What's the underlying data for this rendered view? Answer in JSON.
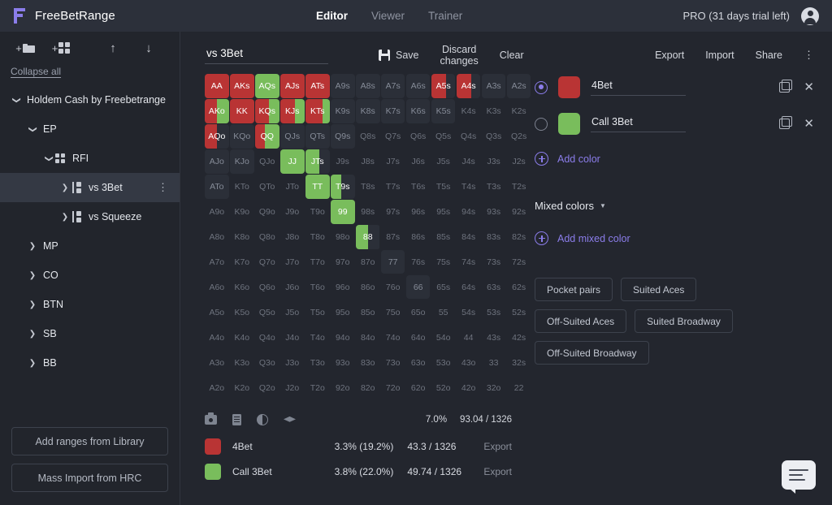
{
  "header": {
    "brand": "FreeBetRange",
    "logo_icon": "freebetrange-logo",
    "nav": [
      {
        "label": "Editor",
        "active": true
      },
      {
        "label": "Viewer",
        "active": false
      },
      {
        "label": "Trainer",
        "active": false
      }
    ],
    "pro_label": "PRO (31 days trial left)",
    "account_icon": "account-circle-icon"
  },
  "sidebar": {
    "tools": [
      {
        "name": "add-folder",
        "icon": "plus-folder-icon"
      },
      {
        "name": "add-range",
        "icon": "plus-grid-icon"
      },
      {
        "name": "move-up",
        "icon": "arrow-up-icon"
      },
      {
        "name": "move-down",
        "icon": "arrow-down-icon"
      }
    ],
    "collapse_all": "Collapse all",
    "tree": [
      {
        "label": "Holdem Cash by Freebetrange",
        "indent": 0,
        "chevron": "down",
        "icon": null,
        "selected": false
      },
      {
        "label": "EP",
        "indent": 1,
        "chevron": "down",
        "icon": null,
        "selected": false
      },
      {
        "label": "RFI",
        "indent": 2,
        "chevron": "down",
        "icon": "grid",
        "selected": false
      },
      {
        "label": "vs 3Bet",
        "indent": 3,
        "chevron": "right",
        "icon": "range",
        "selected": true
      },
      {
        "label": "vs Squeeze",
        "indent": 3,
        "chevron": "right",
        "icon": "range",
        "selected": false
      },
      {
        "label": "MP",
        "indent": 1,
        "chevron": "right",
        "icon": null,
        "selected": false
      },
      {
        "label": "CO",
        "indent": 1,
        "chevron": "right",
        "icon": null,
        "selected": false
      },
      {
        "label": "BTN",
        "indent": 1,
        "chevron": "right",
        "icon": null,
        "selected": false
      },
      {
        "label": "SB",
        "indent": 1,
        "chevron": "right",
        "icon": null,
        "selected": false
      },
      {
        "label": "BB",
        "indent": 1,
        "chevron": "right",
        "icon": null,
        "selected": false
      }
    ],
    "buttons": [
      {
        "label": "Add ranges from Library"
      },
      {
        "label": "Mass Import from HRC"
      }
    ]
  },
  "editor": {
    "range_name": "vs 3Bet",
    "actions": [
      {
        "label": "Save",
        "icon": "save-icon"
      },
      {
        "label": "Discard changes",
        "icon": null
      },
      {
        "label": "Clear",
        "icon": null
      }
    ],
    "mini_tools": [
      {
        "name": "screenshot",
        "icon": "camera-icon"
      },
      {
        "name": "notes",
        "icon": "document-icon"
      },
      {
        "name": "contrast",
        "icon": "contrast-icon"
      },
      {
        "name": "study",
        "icon": "graduation-cap-icon"
      }
    ],
    "total_pct": "7.0%",
    "total_combos": "93.04 / 1326",
    "legend": [
      {
        "color": "#b93434",
        "name": "4Bet",
        "pct": "3.3% (19.2%)",
        "combos": "43.3 / 1326",
        "export": "Export"
      },
      {
        "color": "#79bd5c",
        "name": "Call 3Bet",
        "pct": "3.8% (22.0%)",
        "combos": "49.74 / 1326",
        "export": "Export"
      }
    ]
  },
  "right_panel": {
    "actions": [
      {
        "label": "Export"
      },
      {
        "label": "Import"
      },
      {
        "label": "Share"
      }
    ],
    "kebab_icon": "more-vertical-icon",
    "colors": [
      {
        "name": "4Bet",
        "color": "#b93434",
        "selected": true,
        "copy_icon": "copy-icon",
        "delete_icon": "close-icon"
      },
      {
        "name": "Call 3Bet",
        "color": "#79bd5c",
        "selected": false,
        "copy_icon": "copy-icon",
        "delete_icon": "close-icon"
      }
    ],
    "add_color": "Add color",
    "mixed_colors_title": "Mixed colors",
    "add_mixed_color": "Add mixed color",
    "presets": [
      "Pocket pairs",
      "Suited Aces",
      "Off-Suited Aces",
      "Suited Broadway",
      "Off-Suited Broadway"
    ]
  },
  "chat_icon": "chat-bubble-icon",
  "palette": {
    "red": "#b93434",
    "green": "#79bd5c",
    "empty": "#2b2f38",
    "accent": "#8b7dea"
  },
  "matrix": {
    "ranks": [
      "A",
      "K",
      "Q",
      "J",
      "T",
      "9",
      "8",
      "7",
      "6",
      "5",
      "4",
      "3",
      "2"
    ],
    "cells": [
      {
        "h": "AA",
        "red": 100,
        "green": 0
      },
      {
        "h": "AKs",
        "red": 100,
        "green": 0
      },
      {
        "h": "AQs",
        "red": 0,
        "green": 100
      },
      {
        "h": "AJs",
        "red": 100,
        "green": 0
      },
      {
        "h": "ATs",
        "red": 100,
        "green": 0
      },
      {
        "h": "A9s",
        "red": 0,
        "green": 0,
        "hl": true
      },
      {
        "h": "A8s",
        "red": 0,
        "green": 0,
        "hl": true
      },
      {
        "h": "A7s",
        "red": 0,
        "green": 0,
        "hl": true
      },
      {
        "h": "A6s",
        "red": 0,
        "green": 0,
        "hl": true
      },
      {
        "h": "A5s",
        "red": 62,
        "green": 0,
        "hl": true
      },
      {
        "h": "A4s",
        "red": 62,
        "green": 0,
        "hl": true
      },
      {
        "h": "A3s",
        "red": 0,
        "green": 0,
        "hl": true
      },
      {
        "h": "A2s",
        "red": 0,
        "green": 0,
        "hl": true
      },
      {
        "h": "AKo",
        "red": 52,
        "green": 48
      },
      {
        "h": "KK",
        "red": 100,
        "green": 0
      },
      {
        "h": "KQs",
        "red": 58,
        "green": 42
      },
      {
        "h": "KJs",
        "red": 62,
        "green": 38
      },
      {
        "h": "KTs",
        "red": 70,
        "green": 30
      },
      {
        "h": "K9s",
        "red": 0,
        "green": 0,
        "hl": true
      },
      {
        "h": "K8s",
        "red": 0,
        "green": 0,
        "hl": true
      },
      {
        "h": "K7s",
        "red": 0,
        "green": 0,
        "hl": true
      },
      {
        "h": "K6s",
        "red": 0,
        "green": 0,
        "hl": true
      },
      {
        "h": "K5s",
        "red": 0,
        "green": 0,
        "hl": true
      },
      {
        "h": "K4s",
        "red": 0,
        "green": 0
      },
      {
        "h": "K3s",
        "red": 0,
        "green": 0
      },
      {
        "h": "K2s",
        "red": 0,
        "green": 0
      },
      {
        "h": "AQo",
        "red": 52,
        "green": 0,
        "hl": true
      },
      {
        "h": "KQo",
        "red": 0,
        "green": 0,
        "hl": true
      },
      {
        "h": "QQ",
        "red": 40,
        "green": 60
      },
      {
        "h": "QJs",
        "red": 0,
        "green": 0,
        "hl": true
      },
      {
        "h": "QTs",
        "red": 0,
        "green": 0,
        "hl": true
      },
      {
        "h": "Q9s",
        "red": 0,
        "green": 0,
        "hl": true
      },
      {
        "h": "Q8s",
        "red": 0,
        "green": 0
      },
      {
        "h": "Q7s",
        "red": 0,
        "green": 0
      },
      {
        "h": "Q6s",
        "red": 0,
        "green": 0
      },
      {
        "h": "Q5s",
        "red": 0,
        "green": 0
      },
      {
        "h": "Q4s",
        "red": 0,
        "green": 0
      },
      {
        "h": "Q3s",
        "red": 0,
        "green": 0
      },
      {
        "h": "Q2s",
        "red": 0,
        "green": 0
      },
      {
        "h": "AJo",
        "red": 0,
        "green": 0,
        "hl": true
      },
      {
        "h": "KJo",
        "red": 0,
        "green": 0,
        "hl": true
      },
      {
        "h": "QJo",
        "red": 0,
        "green": 0
      },
      {
        "h": "JJ",
        "red": 0,
        "green": 100
      },
      {
        "h": "JTs",
        "red": 0,
        "green": 58,
        "hl": true
      },
      {
        "h": "J9s",
        "red": 0,
        "green": 0
      },
      {
        "h": "J8s",
        "red": 0,
        "green": 0
      },
      {
        "h": "J7s",
        "red": 0,
        "green": 0
      },
      {
        "h": "J6s",
        "red": 0,
        "green": 0
      },
      {
        "h": "J5s",
        "red": 0,
        "green": 0
      },
      {
        "h": "J4s",
        "red": 0,
        "green": 0
      },
      {
        "h": "J3s",
        "red": 0,
        "green": 0
      },
      {
        "h": "J2s",
        "red": 0,
        "green": 0
      },
      {
        "h": "ATo",
        "red": 0,
        "green": 0,
        "hl": true
      },
      {
        "h": "KTo",
        "red": 0,
        "green": 0
      },
      {
        "h": "QTo",
        "red": 0,
        "green": 0
      },
      {
        "h": "JTo",
        "red": 0,
        "green": 0
      },
      {
        "h": "TT",
        "red": 0,
        "green": 100
      },
      {
        "h": "T9s",
        "red": 0,
        "green": 45,
        "hl": true
      },
      {
        "h": "T8s",
        "red": 0,
        "green": 0
      },
      {
        "h": "T7s",
        "red": 0,
        "green": 0
      },
      {
        "h": "T6s",
        "red": 0,
        "green": 0
      },
      {
        "h": "T5s",
        "red": 0,
        "green": 0
      },
      {
        "h": "T4s",
        "red": 0,
        "green": 0
      },
      {
        "h": "T3s",
        "red": 0,
        "green": 0
      },
      {
        "h": "T2s",
        "red": 0,
        "green": 0
      },
      {
        "h": "A9o",
        "red": 0,
        "green": 0
      },
      {
        "h": "K9o",
        "red": 0,
        "green": 0
      },
      {
        "h": "Q9o",
        "red": 0,
        "green": 0
      },
      {
        "h": "J9o",
        "red": 0,
        "green": 0
      },
      {
        "h": "T9o",
        "red": 0,
        "green": 0
      },
      {
        "h": "99",
        "red": 0,
        "green": 100
      },
      {
        "h": "98s",
        "red": 0,
        "green": 0
      },
      {
        "h": "97s",
        "red": 0,
        "green": 0
      },
      {
        "h": "96s",
        "red": 0,
        "green": 0
      },
      {
        "h": "95s",
        "red": 0,
        "green": 0
      },
      {
        "h": "94s",
        "red": 0,
        "green": 0
      },
      {
        "h": "93s",
        "red": 0,
        "green": 0
      },
      {
        "h": "92s",
        "red": 0,
        "green": 0
      },
      {
        "h": "A8o",
        "red": 0,
        "green": 0
      },
      {
        "h": "K8o",
        "red": 0,
        "green": 0
      },
      {
        "h": "Q8o",
        "red": 0,
        "green": 0
      },
      {
        "h": "J8o",
        "red": 0,
        "green": 0
      },
      {
        "h": "T8o",
        "red": 0,
        "green": 0
      },
      {
        "h": "98o",
        "red": 0,
        "green": 0
      },
      {
        "h": "88",
        "red": 0,
        "green": 52,
        "hl": true
      },
      {
        "h": "87s",
        "red": 0,
        "green": 0
      },
      {
        "h": "86s",
        "red": 0,
        "green": 0
      },
      {
        "h": "85s",
        "red": 0,
        "green": 0
      },
      {
        "h": "84s",
        "red": 0,
        "green": 0
      },
      {
        "h": "83s",
        "red": 0,
        "green": 0
      },
      {
        "h": "82s",
        "red": 0,
        "green": 0
      },
      {
        "h": "A7o",
        "red": 0,
        "green": 0
      },
      {
        "h": "K7o",
        "red": 0,
        "green": 0
      },
      {
        "h": "Q7o",
        "red": 0,
        "green": 0
      },
      {
        "h": "J7o",
        "red": 0,
        "green": 0
      },
      {
        "h": "T7o",
        "red": 0,
        "green": 0
      },
      {
        "h": "97o",
        "red": 0,
        "green": 0
      },
      {
        "h": "87o",
        "red": 0,
        "green": 0
      },
      {
        "h": "77",
        "red": 0,
        "green": 0,
        "hl": true
      },
      {
        "h": "76s",
        "red": 0,
        "green": 0
      },
      {
        "h": "75s",
        "red": 0,
        "green": 0
      },
      {
        "h": "74s",
        "red": 0,
        "green": 0
      },
      {
        "h": "73s",
        "red": 0,
        "green": 0
      },
      {
        "h": "72s",
        "red": 0,
        "green": 0
      },
      {
        "h": "A6o",
        "red": 0,
        "green": 0
      },
      {
        "h": "K6o",
        "red": 0,
        "green": 0
      },
      {
        "h": "Q6o",
        "red": 0,
        "green": 0
      },
      {
        "h": "J6o",
        "red": 0,
        "green": 0
      },
      {
        "h": "T6o",
        "red": 0,
        "green": 0
      },
      {
        "h": "96o",
        "red": 0,
        "green": 0
      },
      {
        "h": "86o",
        "red": 0,
        "green": 0
      },
      {
        "h": "76o",
        "red": 0,
        "green": 0
      },
      {
        "h": "66",
        "red": 0,
        "green": 0,
        "hl": true
      },
      {
        "h": "65s",
        "red": 0,
        "green": 0
      },
      {
        "h": "64s",
        "red": 0,
        "green": 0
      },
      {
        "h": "63s",
        "red": 0,
        "green": 0
      },
      {
        "h": "62s",
        "red": 0,
        "green": 0
      },
      {
        "h": "A5o",
        "red": 0,
        "green": 0
      },
      {
        "h": "K5o",
        "red": 0,
        "green": 0
      },
      {
        "h": "Q5o",
        "red": 0,
        "green": 0
      },
      {
        "h": "J5o",
        "red": 0,
        "green": 0
      },
      {
        "h": "T5o",
        "red": 0,
        "green": 0
      },
      {
        "h": "95o",
        "red": 0,
        "green": 0
      },
      {
        "h": "85o",
        "red": 0,
        "green": 0
      },
      {
        "h": "75o",
        "red": 0,
        "green": 0
      },
      {
        "h": "65o",
        "red": 0,
        "green": 0
      },
      {
        "h": "55",
        "red": 0,
        "green": 0
      },
      {
        "h": "54s",
        "red": 0,
        "green": 0
      },
      {
        "h": "53s",
        "red": 0,
        "green": 0
      },
      {
        "h": "52s",
        "red": 0,
        "green": 0
      },
      {
        "h": "A4o",
        "red": 0,
        "green": 0
      },
      {
        "h": "K4o",
        "red": 0,
        "green": 0
      },
      {
        "h": "Q4o",
        "red": 0,
        "green": 0
      },
      {
        "h": "J4o",
        "red": 0,
        "green": 0
      },
      {
        "h": "T4o",
        "red": 0,
        "green": 0
      },
      {
        "h": "94o",
        "red": 0,
        "green": 0
      },
      {
        "h": "84o",
        "red": 0,
        "green": 0
      },
      {
        "h": "74o",
        "red": 0,
        "green": 0
      },
      {
        "h": "64o",
        "red": 0,
        "green": 0
      },
      {
        "h": "54o",
        "red": 0,
        "green": 0
      },
      {
        "h": "44",
        "red": 0,
        "green": 0
      },
      {
        "h": "43s",
        "red": 0,
        "green": 0
      },
      {
        "h": "42s",
        "red": 0,
        "green": 0
      },
      {
        "h": "A3o",
        "red": 0,
        "green": 0
      },
      {
        "h": "K3o",
        "red": 0,
        "green": 0
      },
      {
        "h": "Q3o",
        "red": 0,
        "green": 0
      },
      {
        "h": "J3o",
        "red": 0,
        "green": 0
      },
      {
        "h": "T3o",
        "red": 0,
        "green": 0
      },
      {
        "h": "93o",
        "red": 0,
        "green": 0
      },
      {
        "h": "83o",
        "red": 0,
        "green": 0
      },
      {
        "h": "73o",
        "red": 0,
        "green": 0
      },
      {
        "h": "63o",
        "red": 0,
        "green": 0
      },
      {
        "h": "53o",
        "red": 0,
        "green": 0
      },
      {
        "h": "43o",
        "red": 0,
        "green": 0
      },
      {
        "h": "33",
        "red": 0,
        "green": 0
      },
      {
        "h": "32s",
        "red": 0,
        "green": 0
      },
      {
        "h": "A2o",
        "red": 0,
        "green": 0
      },
      {
        "h": "K2o",
        "red": 0,
        "green": 0
      },
      {
        "h": "Q2o",
        "red": 0,
        "green": 0
      },
      {
        "h": "J2o",
        "red": 0,
        "green": 0
      },
      {
        "h": "T2o",
        "red": 0,
        "green": 0
      },
      {
        "h": "92o",
        "red": 0,
        "green": 0
      },
      {
        "h": "82o",
        "red": 0,
        "green": 0
      },
      {
        "h": "72o",
        "red": 0,
        "green": 0
      },
      {
        "h": "62o",
        "red": 0,
        "green": 0
      },
      {
        "h": "52o",
        "red": 0,
        "green": 0
      },
      {
        "h": "42o",
        "red": 0,
        "green": 0
      },
      {
        "h": "32o",
        "red": 0,
        "green": 0
      },
      {
        "h": "22",
        "red": 0,
        "green": 0
      }
    ]
  }
}
